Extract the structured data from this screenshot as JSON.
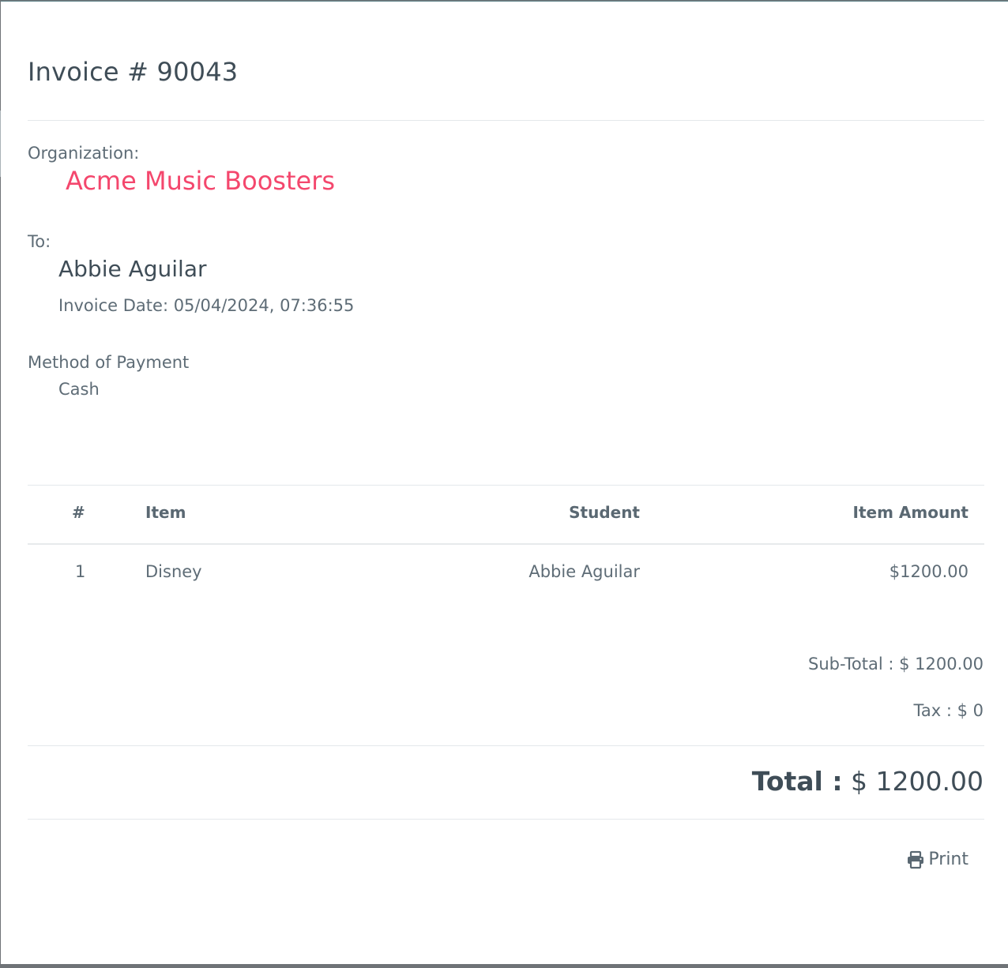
{
  "invoice": {
    "title": "Invoice # 90043"
  },
  "organization": {
    "label": "Organization:",
    "name": "Acme Music Boosters"
  },
  "recipient": {
    "label": "To:",
    "name": "Abbie Aguilar",
    "invoice_date": "Invoice Date: 05/04/2024, 07:36:55"
  },
  "payment": {
    "label": "Method of Payment",
    "method": "Cash"
  },
  "table": {
    "headers": [
      "#",
      "Item",
      "Student",
      "Item Amount"
    ],
    "rows": [
      [
        "1",
        "Disney",
        "Abbie Aguilar",
        "$1200.00"
      ]
    ]
  },
  "summary": {
    "subtotal": "Sub-Total : $ 1200.00",
    "tax": "Tax : $ 0",
    "total_label": "Total :",
    "total_value": " $ 1200.00"
  },
  "actions": {
    "print_label": "Print",
    "print_icon": "printer-icon"
  },
  "colors": {
    "accent": "#f4476d",
    "text": "#4a5a66"
  }
}
